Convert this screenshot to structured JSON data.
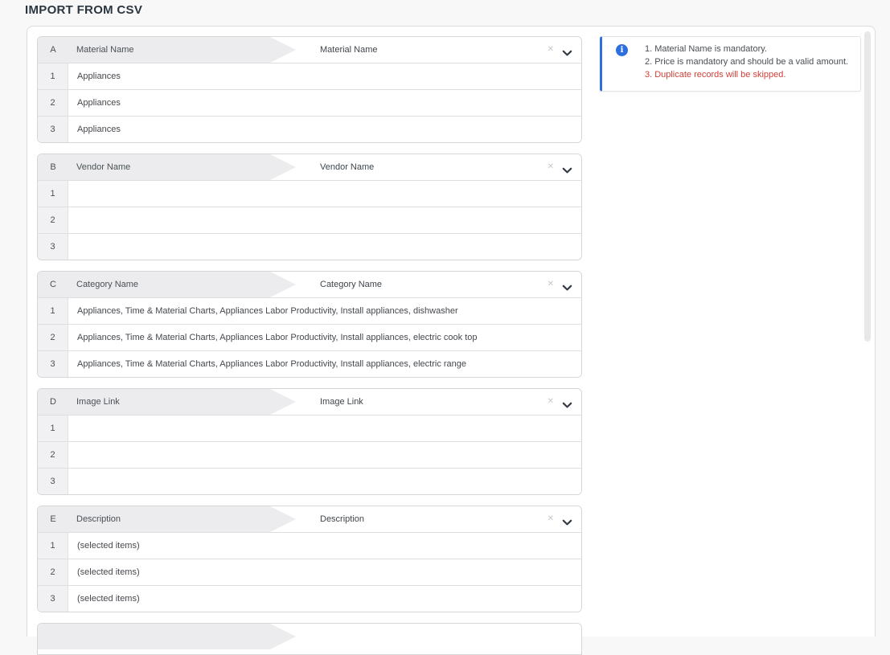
{
  "page": {
    "title": "IMPORT FROM CSV"
  },
  "colors": {
    "accent_blue": "#2e6fe0",
    "error_red": "#cf4039",
    "header_gray": "#ececee",
    "card_border": "#d6d6d8",
    "title_color": "#2b3640"
  },
  "icons": {
    "info_glyph": "i",
    "clear_glyph": "✕",
    "chevron_down": "chevron-down"
  },
  "row_numbers": [
    "1",
    "2",
    "3"
  ],
  "columns": [
    {
      "letter": "A",
      "source_label": "Material Name",
      "mapped_field": "Material Name",
      "rows": [
        "Appliances",
        "Appliances",
        "Appliances"
      ]
    },
    {
      "letter": "B",
      "source_label": "Vendor Name",
      "mapped_field": "Vendor Name",
      "rows": [
        "",
        "",
        ""
      ]
    },
    {
      "letter": "C",
      "source_label": "Category Name",
      "mapped_field": "Category Name",
      "rows": [
        "Appliances, Time & Material Charts, Appliances Labor Productivity, Install appliances, dishwasher",
        "Appliances, Time & Material Charts, Appliances Labor Productivity, Install appliances, electric cook top",
        "Appliances, Time & Material Charts, Appliances Labor Productivity, Install appliances, electric range"
      ]
    },
    {
      "letter": "D",
      "source_label": "Image Link",
      "mapped_field": "Image Link",
      "rows": [
        "",
        "",
        ""
      ]
    },
    {
      "letter": "E",
      "source_label": "Description",
      "mapped_field": "Description",
      "rows": [
        "(selected items)",
        "(selected items)",
        "(selected items)"
      ]
    }
  ],
  "notes": {
    "items": [
      {
        "num": "1.",
        "text": "Material Name is mandatory."
      },
      {
        "num": "2.",
        "text": "Price is mandatory and should be a valid amount."
      },
      {
        "num": "3.",
        "text": "Duplicate records will be skipped."
      }
    ]
  }
}
